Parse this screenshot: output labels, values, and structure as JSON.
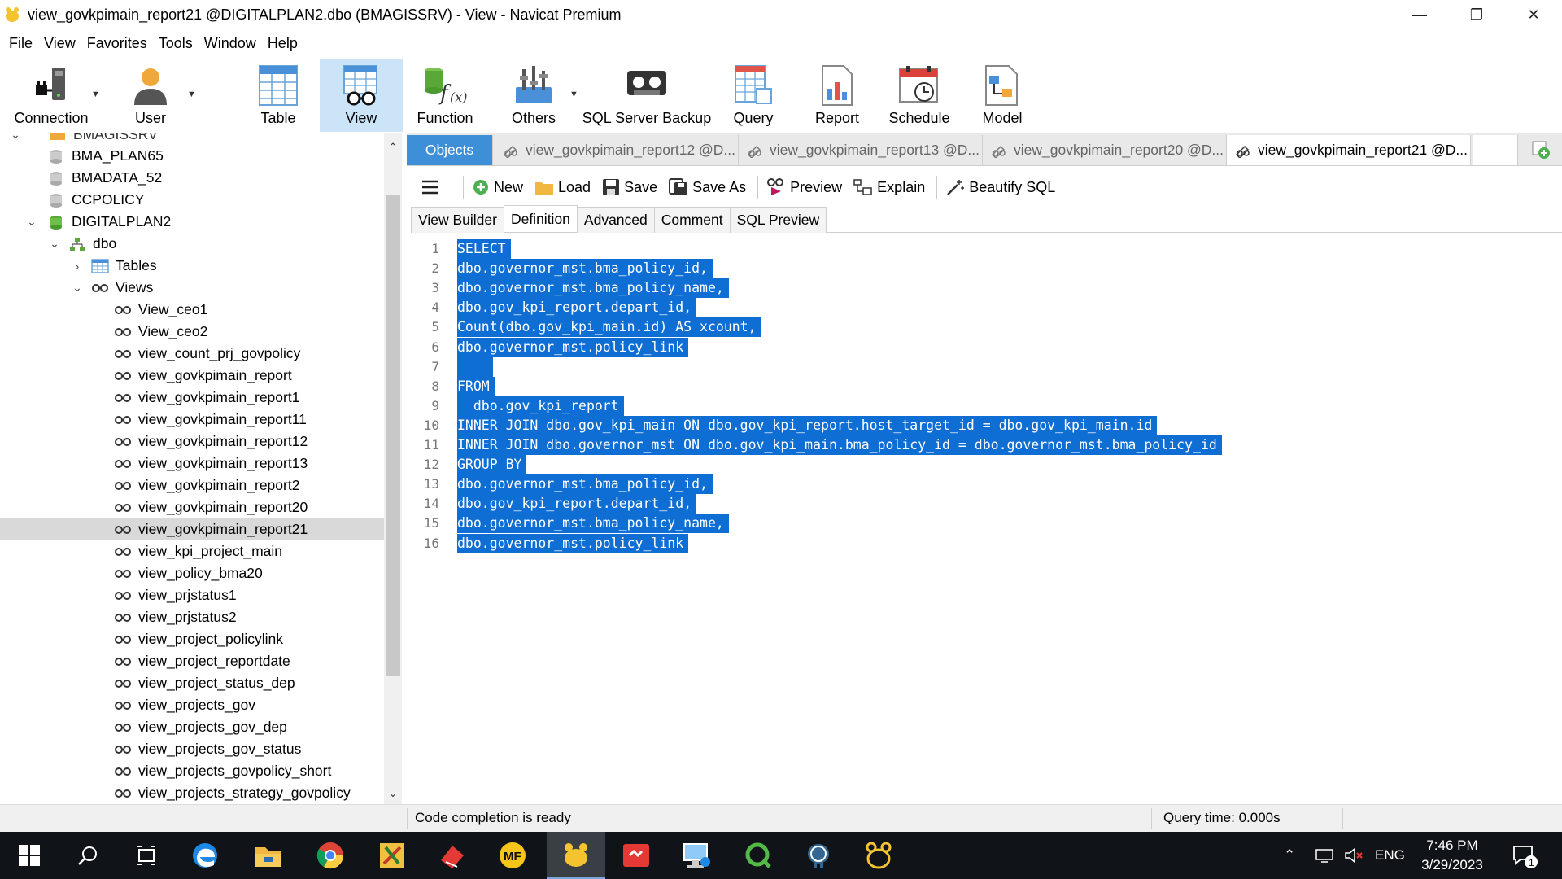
{
  "window": {
    "title": "view_govkpimain_report21 @DIGITALPLAN2.dbo (BMAGISSRV) - View - Navicat Premium",
    "controls": [
      "minimize-icon",
      "restore-icon",
      "close-icon"
    ]
  },
  "menu": [
    "File",
    "View",
    "Favorites",
    "Tools",
    "Window",
    "Help"
  ],
  "toolbar": {
    "connection": "Connection",
    "user": "User",
    "table": "Table",
    "view": "View",
    "function": "Function",
    "others": "Others",
    "backup": "SQL Server Backup",
    "query": "Query",
    "report": "Report",
    "schedule": "Schedule",
    "model": "Model"
  },
  "tree": {
    "server_partial": "BMAGISSRV",
    "databases": [
      "BMA_PLAN65",
      "BMADATA_52",
      "CCPOLICY",
      "DIGITALPLAN2"
    ],
    "schema": "dbo",
    "tables_label": "Tables",
    "views_label": "Views",
    "views": [
      "View_ceo1",
      "View_ceo2",
      "view_count_prj_govpolicy",
      "view_govkpimain_report",
      "view_govkpimain_report1",
      "view_govkpimain_report11",
      "view_govkpimain_report12",
      "view_govkpimain_report13",
      "view_govkpimain_report2",
      "view_govkpimain_report20",
      "view_govkpimain_report21",
      "view_kpi_project_main",
      "view_policy_bma20",
      "view_prjstatus1",
      "view_prjstatus2",
      "view_project_policylink",
      "view_project_reportdate",
      "view_project_status_dep",
      "view_projects_gov",
      "view_projects_gov_dep",
      "view_projects_gov_status",
      "view_projects_govpolicy_short",
      "view_projects_strategy_govpolicy"
    ],
    "selected": "view_govkpimain_report21"
  },
  "tabs": {
    "objects": "Objects",
    "items": [
      "view_govkpimain_report12 @D...",
      "view_govkpimain_report13 @D...",
      "view_govkpimain_report20 @D...",
      "view_govkpimain_report21 @D..."
    ]
  },
  "subtoolbar": {
    "new": "New",
    "load": "Load",
    "save": "Save",
    "save_as": "Save As",
    "preview": "Preview",
    "explain": "Explain",
    "beautify": "Beautify SQL"
  },
  "deftabs": [
    "View Builder",
    "Definition",
    "Advanced",
    "Comment",
    "SQL Preview"
  ],
  "sql_lines": [
    "SELECT",
    "dbo.governor_mst.bma_policy_id,",
    "dbo.governor_mst.bma_policy_name,",
    "dbo.gov_kpi_report.depart_id,",
    "Count(dbo.gov_kpi_main.id) AS xcount,",
    "dbo.governor_mst.policy_link",
    "",
    "FROM",
    "  dbo.gov_kpi_report",
    "INNER JOIN dbo.gov_kpi_main ON dbo.gov_kpi_report.host_target_id = dbo.gov_kpi_main.id",
    "INNER JOIN dbo.governor_mst ON dbo.gov_kpi_main.bma_policy_id = dbo.governor_mst.bma_policy_id",
    "GROUP BY",
    "dbo.governor_mst.bma_policy_id,",
    "dbo.gov_kpi_report.depart_id,",
    "dbo.governor_mst.bma_policy_name,",
    "dbo.governor_mst.policy_link"
  ],
  "status": {
    "left": "Code completion is ready",
    "right": "Query time: 0.000s"
  },
  "taskbar": {
    "lang": "ENG",
    "time": "7:46 PM",
    "date": "3/29/2023",
    "notifications": "1"
  },
  "colors": {
    "selection": "#0f6ed4",
    "objects_tab": "#3d8fd8",
    "active_toolbar": "#cce4f7"
  }
}
